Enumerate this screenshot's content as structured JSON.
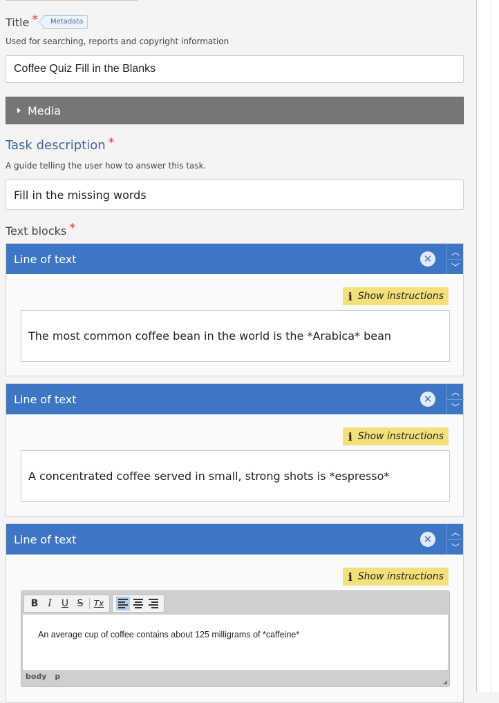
{
  "title_field": {
    "label": "Title",
    "required_mark": "*",
    "metadata_label": "Metadata",
    "description": "Used for searching, reports and copyright information",
    "value": "Coffee Quiz Fill in the Blanks"
  },
  "media": {
    "label": "Media"
  },
  "task_description": {
    "label": "Task description",
    "required_mark": "*",
    "description": "A guide telling the user how to answer this task.",
    "value": "Fill in the missing words"
  },
  "text_blocks": {
    "label": "Text blocks",
    "required_mark": "*",
    "items": [
      {
        "header": "Line of text",
        "instructions_label": "Show instructions",
        "text": "The most common coffee bean in the world is the *Arabica* bean"
      },
      {
        "header": "Line of text",
        "instructions_label": "Show instructions",
        "text": "A concentrated coffee served in small, strong shots is *espresso*"
      },
      {
        "header": "Line of text",
        "instructions_label": "Show instructions",
        "text": "An average cup of coffee contains about 125 milligrams of *caffeine*"
      }
    ]
  },
  "editor": {
    "toolbar": {
      "bold": "B",
      "italic": "I",
      "underline": "U",
      "strike": "S",
      "remove_format": "Tx"
    },
    "status_path": [
      "body",
      "p"
    ]
  },
  "icons": {
    "remove": "close-icon",
    "move_up": "chevron-up-icon",
    "move_down": "chevron-down-icon",
    "info": "info-icon",
    "expand": "caret-right-icon"
  },
  "colors": {
    "header_blue": "#3d76c4",
    "media_gray": "#767676",
    "instructions_yellow": "#f3e07a",
    "required_red": "#d8383e",
    "task_label_blue": "#3f6799"
  }
}
